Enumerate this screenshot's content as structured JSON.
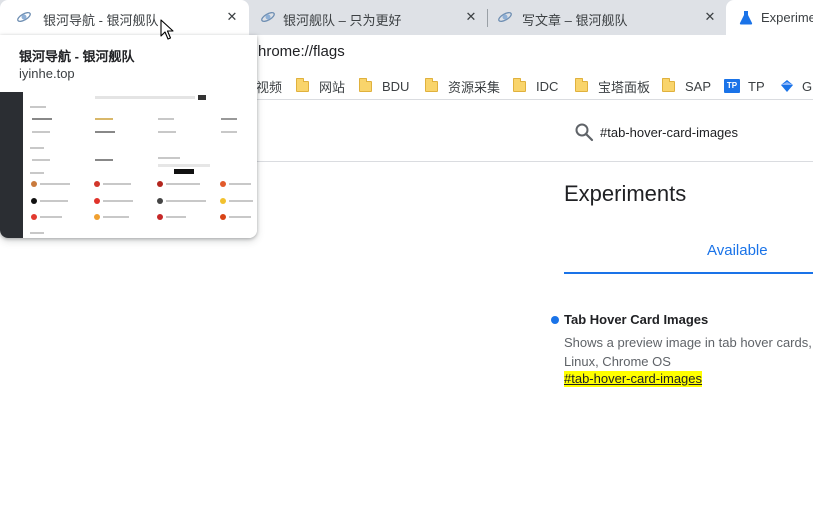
{
  "tabs": [
    {
      "title": "银河导航 - 银河舰队",
      "active": true
    },
    {
      "title": "银河舰队 – 只为更好",
      "active": false
    },
    {
      "title": "写文章 – 银河舰队",
      "active": false
    },
    {
      "title": "Experime",
      "active": false
    }
  ],
  "address": {
    "text": "hrome://flags"
  },
  "bookmarks": [
    {
      "label": "视频",
      "icon": "folder-icon"
    },
    {
      "label": "网站",
      "icon": "folder-icon"
    },
    {
      "label": "BDU",
      "icon": "folder-icon"
    },
    {
      "label": "资源采集",
      "icon": "folder-icon"
    },
    {
      "label": "IDC",
      "icon": "folder-icon"
    },
    {
      "label": "宝塔面板",
      "icon": "folder-icon"
    },
    {
      "label": "SAP",
      "icon": "folder-icon"
    },
    {
      "label": "TP",
      "icon": "tp-icon",
      "badge": "TP"
    },
    {
      "label": "G",
      "icon": "gem-icon"
    }
  ],
  "hover_card": {
    "title": "银河导航 - 银河舰队",
    "domain": "iyinhe.top"
  },
  "flags": {
    "search_value": "#tab-hover-card-images",
    "page_title": "Experiments",
    "tab_available": "Available",
    "flag_name": "Tab Hover Card Images",
    "flag_desc_line1": "Shows a preview image in tab hover cards, i",
    "flag_desc_line2": "Linux, Chrome OS",
    "flag_link": "#tab-hover-card-images"
  },
  "colors": {
    "accent": "#1a73e8",
    "tabstrip": "#dee1e6",
    "highlight": "#ffff00",
    "folder": "#f9d46b"
  }
}
